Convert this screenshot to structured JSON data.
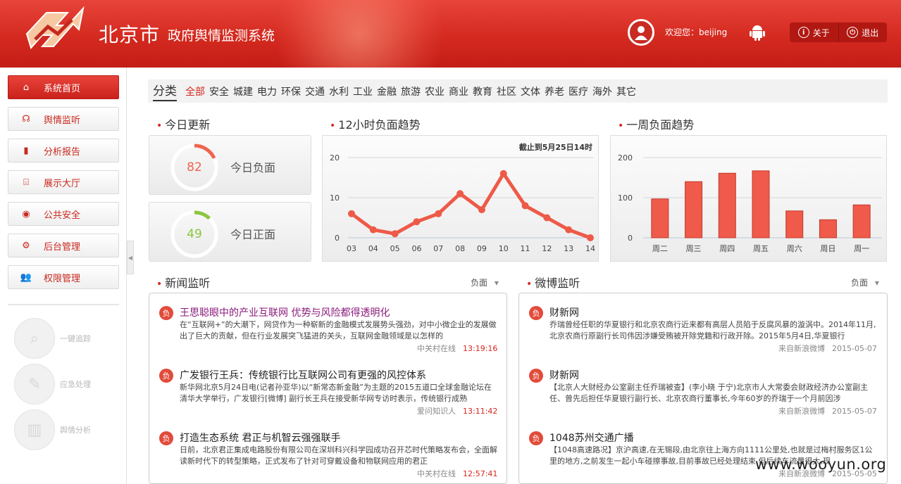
{
  "header": {
    "title": "北京市",
    "subtitle": "政府舆情监测系统",
    "welcome": "欢迎您：beijing",
    "about_label": "关于",
    "logout_label": "退出"
  },
  "sidebar": {
    "items": [
      {
        "label": "系统首页",
        "icon": "home-icon",
        "active": true
      },
      {
        "label": "舆情监听",
        "icon": "headphones-icon",
        "active": false
      },
      {
        "label": "分析报告",
        "icon": "bar-chart-icon",
        "active": false
      },
      {
        "label": "展示大厅",
        "icon": "building-icon",
        "active": false
      },
      {
        "label": "公共安全",
        "icon": "camera-icon",
        "active": false
      },
      {
        "label": "后台管理",
        "icon": "settings-icon",
        "active": false
      },
      {
        "label": "权限管理",
        "icon": "users-icon",
        "active": false
      }
    ],
    "tools": [
      {
        "label": "一键追踪",
        "icon": "search-icon"
      },
      {
        "label": "应急处理",
        "icon": "edit-icon"
      },
      {
        "label": "舆情分析",
        "icon": "chart-icon"
      }
    ]
  },
  "categories": {
    "label": "分类",
    "items": [
      "全部",
      "安全",
      "城建",
      "电力",
      "环保",
      "交通",
      "水利",
      "工业",
      "金融",
      "旅游",
      "农业",
      "商业",
      "教育",
      "社区",
      "文体",
      "养老",
      "医疗",
      "海外",
      "其它"
    ],
    "active_index": 0
  },
  "today": {
    "title": "今日更新",
    "negative": {
      "value": 82,
      "label": "今日负面",
      "color": "#f0644f",
      "fraction": 0.18
    },
    "positive": {
      "value": 49,
      "label": "今日正面",
      "color": "#8cc63f",
      "fraction": 0.12
    }
  },
  "trend12": {
    "title": "12小时负面趋势",
    "note": "截止到5月25日14时"
  },
  "week": {
    "title": "一周负面趋势"
  },
  "chart_data": [
    {
      "type": "line",
      "x": [
        "03",
        "04",
        "05",
        "06",
        "07",
        "08",
        "09",
        "10",
        "11",
        "12",
        "13",
        "14"
      ],
      "values": [
        6,
        2,
        1,
        4,
        6,
        11,
        7,
        16,
        8,
        5,
        2,
        0
      ],
      "ylim": [
        0,
        20
      ],
      "yticks": [
        0,
        10,
        20
      ],
      "grid": true,
      "color": "#ee5a48"
    },
    {
      "type": "bar",
      "categories": [
        "周二",
        "周三",
        "周四",
        "周五",
        "周六",
        "周日",
        "周一"
      ],
      "values": [
        97,
        140,
        161,
        167,
        67,
        45,
        82
      ],
      "ylim": [
        0,
        200
      ],
      "yticks": [
        0,
        100,
        200
      ],
      "grid": true,
      "color": "#f05a4a"
    }
  ],
  "news": {
    "title": "新闻监听",
    "filter": "负面",
    "badge": "负",
    "items": [
      {
        "title": "王思聪眼中的产业互联网 优势与风险都得透明化",
        "body": "在“互联网+”的大潮下，网贷作为一种崭新的金融模式发展势头强劲，对中小微企业的发展做出了巨大的贡献，但在行业发展突飞猛进的关头，互联网金融领域是以怎样的",
        "source": "中关村在线",
        "time": "13:19:16",
        "highlight": true
      },
      {
        "title": "广发银行王兵：传统银行比互联网公司有更强的风控体系",
        "body": "新华网北京5月24日电(记者孙亚华)以“新常态新金融”为主题的2015五道口全球金融论坛在清华大学举行，广发银行[微博] 副行长王兵在接受新华网专访时表示，传统银行成熟",
        "source": "爱问知识人",
        "time": "13:11:42",
        "highlight": false
      },
      {
        "title": "打造生态系统 君正与机智云强强联手",
        "body": "日前，北京君正集成电路股份有限公司在深圳科兴科学园成功召开芯时代策略发布会，全面解读新时代下的转型策略，正式发布了针对可穿戴设备和物联网应用的君正",
        "source": "中关村在线",
        "time": "12:57:41",
        "highlight": false
      }
    ]
  },
  "weibo": {
    "title": "微博监听",
    "filter": "负面",
    "badge": "负",
    "items": [
      {
        "title": "财新网",
        "body": "乔瑞曾经任职的华夏银行和北京农商行近来都有高层人员陷于反腐风暴的漩涡中。2014年11月,北京农商行原副行长司伟因涉嫌受贿被开除党籍和行政开除。2015年5月4日,华夏银行",
        "source": "来自新浪微博",
        "time": "2015-05-07"
      },
      {
        "title": "财新网",
        "body": "【北京人大财经办公室副主任乔瑞被查】(李小晓 于宁)北京市人大常委会财政经济办公室副主任、曾先后担任华夏银行副行长、北京农商行董事长,今年60岁的乔瑞于一个月前因涉",
        "source": "来自新浪微博",
        "time": "2015-05-07"
      },
      {
        "title": "1048苏州交通广播",
        "body": "【1048高速路况】京沪高速,在无锡段,由北京往上海方向1111公里处,也就是过梅村服务区1公里的地方,之前发生一起小车碰擦事故,目前事故已经处理结束,但后续车流量很大,现",
        "source": "来自新浪微博",
        "time": "2015-05-05"
      }
    ]
  },
  "watermark": "www.wooyun.org"
}
